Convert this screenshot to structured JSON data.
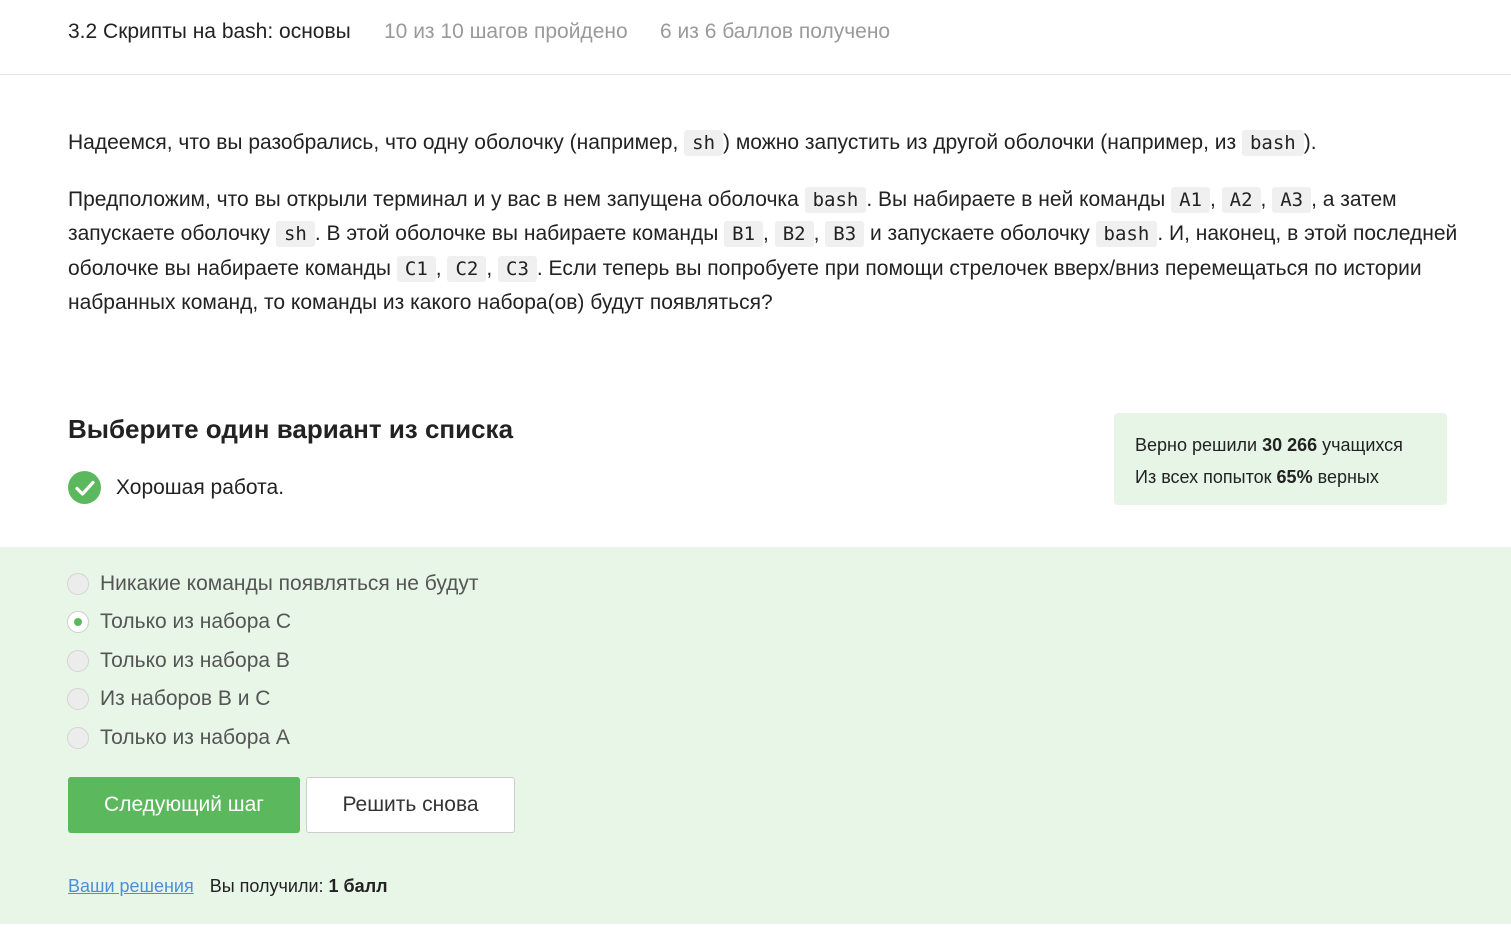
{
  "header": {
    "lesson_title": "3.2 Скрипты на bash: основы",
    "steps_progress": "10 из 10 шагов пройдено",
    "points_progress": "6 из 6 баллов  получено"
  },
  "question": {
    "p1": {
      "t1": "Надеемся, что вы разобрались, что одну оболочку (например, ",
      "c1": "sh",
      "t2": ") можно запустить из другой оболочки (например, из ",
      "c2": "bash",
      "t3": ")."
    },
    "p2": {
      "t1": "Предположим, что вы открыли терминал и у вас в нем запущена оболочка ",
      "c1": "bash",
      "t2": ". Вы набираете в ней команды ",
      "c2": "A1",
      "t3": ", ",
      "c3": "A2",
      "t4": ", ",
      "c4": "A3",
      "t5": ", а затем запускаете оболочку ",
      "c5": "sh",
      "t6": ". В этой оболочке вы набираете команды ",
      "c6": "B1",
      "t7": ", ",
      "c7": "B2",
      "t8": ", ",
      "c8": "B3",
      "t9": " и запускаете оболочку ",
      "c9": "bash",
      "t10": ". И, наконец, в этой последней оболочке вы набираете команды ",
      "c10": "C1",
      "t11": ", ",
      "c11": "C2",
      "t12": ", ",
      "c12": "C3",
      "t13": ". Если теперь вы попробуете при помощи стрелочек вверх/вниз перемещаться по истории набранных команд, то команды из какого набора(ов) будут появляться?"
    }
  },
  "quiz": {
    "title": "Выберите один вариант из списка",
    "feedback": "Хорошая работа.",
    "options": [
      {
        "label": "Никакие команды появляться не будут",
        "selected": false
      },
      {
        "label": "Только из набора С",
        "selected": true
      },
      {
        "label": "Только из набора В",
        "selected": false
      },
      {
        "label": "Из наборов В и С",
        "selected": false
      },
      {
        "label": "Только из набора А",
        "selected": false
      }
    ]
  },
  "stats": {
    "solved_prefix": "Верно решили ",
    "solved_count": "30 266",
    "solved_suffix": " учащихся",
    "attempts_prefix": "Из всех попыток ",
    "attempts_percent": "65%",
    "attempts_suffix": " верных"
  },
  "actions": {
    "next_label": "Следующий шаг",
    "retry_label": "Решить снова"
  },
  "footer": {
    "solutions_link": "Ваши решения",
    "score_prefix": "Вы получили: ",
    "score_value": "1 балл"
  },
  "colors": {
    "accent_green": "#5cb85c",
    "answer_bg": "#e7f6e7",
    "stats_bg": "#e6f5e6",
    "link_blue": "#4a90d9"
  },
  "icons": {
    "feedback": "check-circle-icon"
  }
}
